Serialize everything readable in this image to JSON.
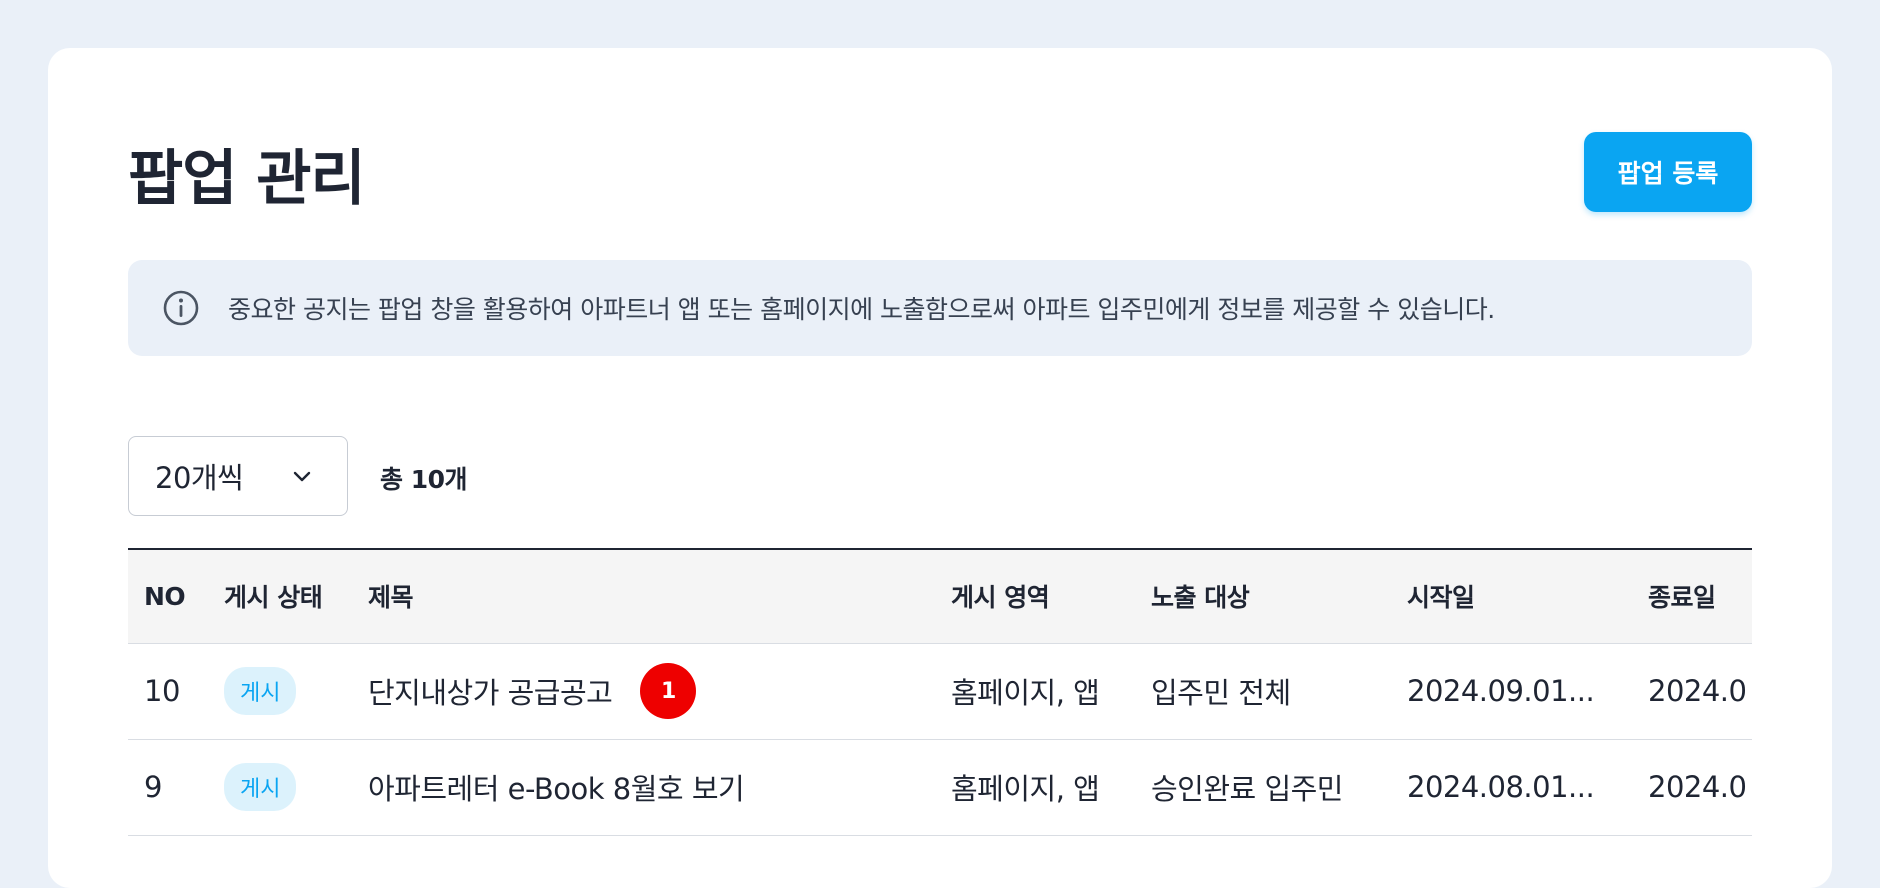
{
  "header": {
    "title": "팝업 관리",
    "register_label": "팝업 등록"
  },
  "notice": {
    "icon": "info-icon",
    "text": "중요한 공지는 팝업 창을 활용하여 아파트너 앱 또는 홈페이지에 노출함으로써 아파트 입주민에게 정보를 제공할 수 있습니다."
  },
  "list_controls": {
    "page_size": "20개씩",
    "total": "총 10개"
  },
  "table": {
    "columns": [
      "NO",
      "게시 상태",
      "제목",
      "게시 영역",
      "노출 대상",
      "시작일",
      "종료일"
    ],
    "rows": [
      {
        "no": "10",
        "status": "게시",
        "title": "단지내상가 공급공고",
        "badge": "1",
        "area": "홈페이지, 앱",
        "target": "입주민 전체",
        "start": "2024.09.01...",
        "end": "2024.0"
      },
      {
        "no": "9",
        "status": "게시",
        "title": "아파트레터 e-Book 8월호 보기",
        "badge": "",
        "area": "홈페이지, 앱",
        "target": "승인완료 입주민",
        "start": "2024.08.01...",
        "end": "2024.0"
      }
    ]
  },
  "colors": {
    "accent": "#0aa5f2",
    "background": "#eaf0f8",
    "badge_red": "#ee0000"
  }
}
